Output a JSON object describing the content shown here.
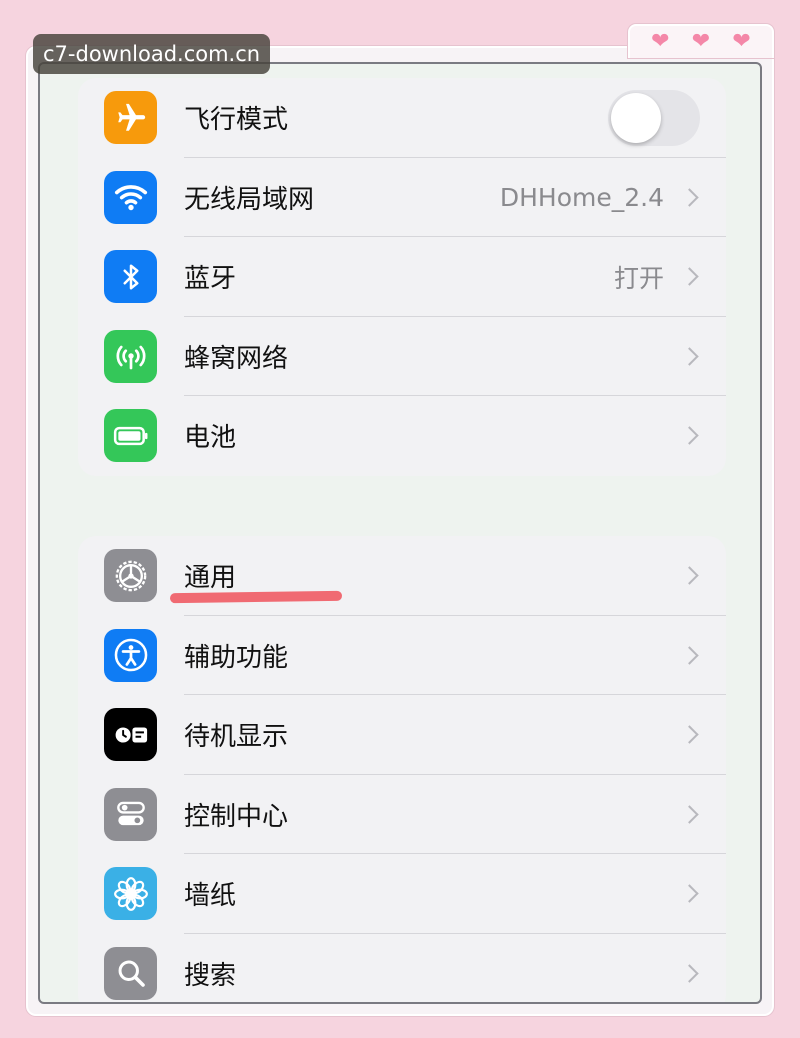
{
  "watermark": "c7-download.com.cn",
  "decoration": {
    "hearts": [
      "❤",
      "❤",
      "❤"
    ]
  },
  "colors": {
    "airplane": "#f79a0c",
    "wifi": "#0f7cf4",
    "bluetooth": "#0f7cf4",
    "cellular": "#34c759",
    "battery": "#34c759",
    "general": "#8e8e93",
    "accessibility": "#0f7cf4",
    "standby": "#000000",
    "control_center": "#8e8e93",
    "wallpaper": "#3ab0e6",
    "search": "#8e8e93",
    "highlight_underline": "#f06a72"
  },
  "connectivity": {
    "airplane": {
      "label": "飞行模式",
      "icon": "airplane-icon",
      "toggle_on": false
    },
    "wifi": {
      "label": "无线局域网",
      "value": "DHHome_2.4",
      "icon": "wifi-icon"
    },
    "bluetooth": {
      "label": "蓝牙",
      "value": "打开",
      "icon": "bluetooth-icon"
    },
    "cellular": {
      "label": "蜂窝网络",
      "icon": "antenna-icon"
    },
    "battery": {
      "label": "电池",
      "icon": "battery-icon"
    }
  },
  "system": {
    "general": {
      "label": "通用",
      "icon": "gear-icon",
      "highlighted": true
    },
    "accessibility": {
      "label": "辅助功能",
      "icon": "accessibility-icon"
    },
    "standby": {
      "label": "待机显示",
      "icon": "standby-icon"
    },
    "control_center": {
      "label": "控制中心",
      "icon": "toggles-icon"
    },
    "wallpaper": {
      "label": "墙纸",
      "icon": "flower-icon"
    },
    "search": {
      "label": "搜索",
      "icon": "magnifier-icon"
    }
  }
}
